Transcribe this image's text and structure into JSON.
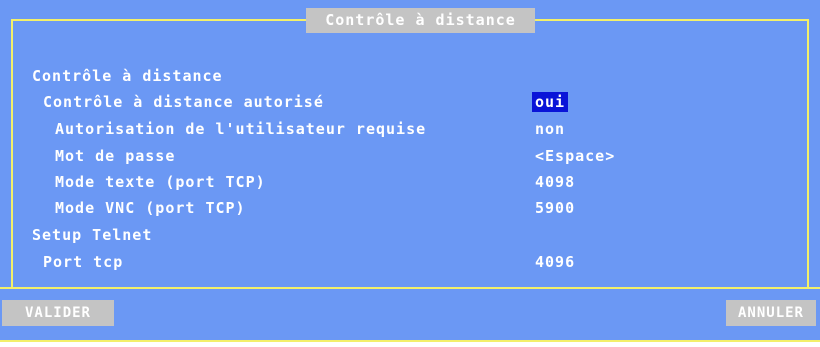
{
  "window": {
    "title": "Contrôle à distance"
  },
  "section_remote": "Contrôle à distance",
  "section_telnet": "Setup Telnet",
  "rows": [
    {
      "label": "Contrôle à distance autorisé",
      "value": "oui"
    },
    {
      "label": "Autorisation de l'utilisateur requise",
      "value": "non"
    },
    {
      "label": "Mot de passe",
      "value": "<Espace>"
    },
    {
      "label": "Mode texte (port TCP)",
      "value": "4098"
    },
    {
      "label": "Mode VNC (port TCP)",
      "value": "5900"
    },
    {
      "label": "Port tcp",
      "value": "4096"
    }
  ],
  "buttons": {
    "validate": "VALIDER",
    "cancel": "ANNULER"
  },
  "colors": {
    "background": "#6b98f4",
    "border": "#f3f06a",
    "selected": "#0a14d8",
    "button": "#c4c4c4"
  }
}
